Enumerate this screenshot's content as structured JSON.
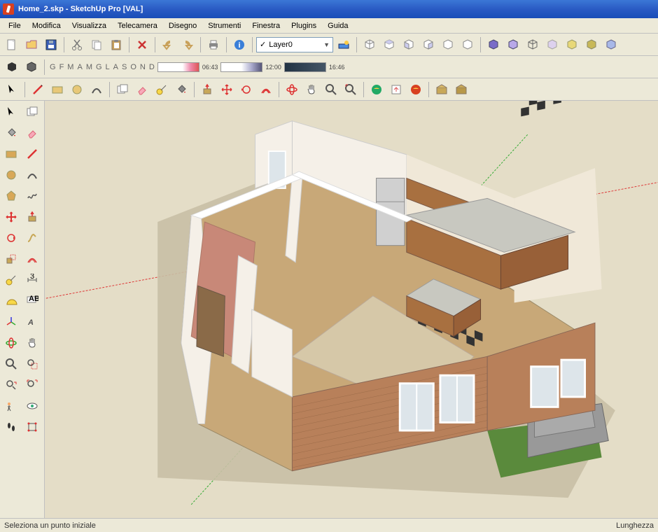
{
  "title": "Home_2.skp - SketchUp Pro [VAL]",
  "menu": {
    "file": "File",
    "modifica": "Modifica",
    "visualizza": "Visualizza",
    "telecamera": "Telecamera",
    "disegno": "Disegno",
    "strumenti": "Strumenti",
    "finestra": "Finestra",
    "plugins": "Plugins",
    "guida": "Guida"
  },
  "layer": {
    "selected": "Layer0"
  },
  "shadow": {
    "months": [
      "G",
      "F",
      "M",
      "A",
      "M",
      "G",
      "L",
      "A",
      "S",
      "O",
      "N",
      "D"
    ],
    "t1": "06:43",
    "t2": "12:00",
    "t3": "16:46"
  },
  "status": {
    "left": "Seleziona un punto iniziale",
    "right": "Lunghezza"
  }
}
